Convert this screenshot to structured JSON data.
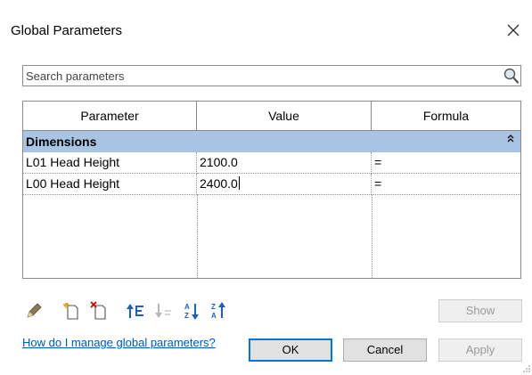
{
  "window": {
    "title": "Global Parameters"
  },
  "search": {
    "placeholder": "Search parameters"
  },
  "grid": {
    "columns": [
      "Parameter",
      "Value",
      "Formula"
    ],
    "group": "Dimensions",
    "rows": [
      {
        "parameter": "L01 Head Height",
        "value": "2100.0",
        "formula": "="
      },
      {
        "parameter": "L00 Head Height",
        "value": "2400.0",
        "formula": "="
      }
    ]
  },
  "toolbar": {
    "icons": [
      "edit-pencil-icon",
      "new-parameter-icon",
      "delete-parameter-icon",
      "move-up-icon",
      "move-down-icon",
      "sort-ascending-icon",
      "sort-descending-icon"
    ]
  },
  "buttons": {
    "show": "Show",
    "ok": "OK",
    "cancel": "Cancel",
    "apply": "Apply"
  },
  "help": {
    "link": "How do I manage global parameters?"
  }
}
